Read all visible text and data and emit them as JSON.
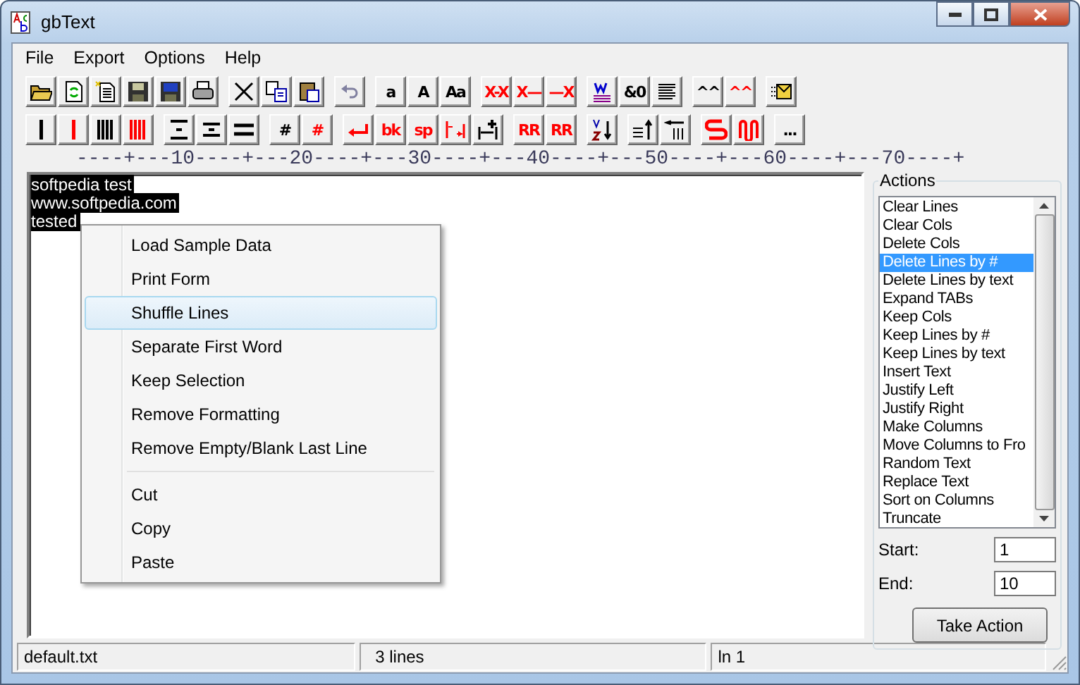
{
  "window": {
    "title": "gbText"
  },
  "menu": [
    "File",
    "Export",
    "Options",
    "Help"
  ],
  "toolbars": [
    [
      [
        {
          "kind": "icon"
        },
        {
          "kind": "icon"
        },
        {
          "kind": "icon"
        },
        {
          "kind": "icon"
        },
        {
          "kind": "icon"
        },
        {
          "kind": "icon"
        }
      ],
      [
        {
          "kind": "icon"
        },
        {
          "kind": "icon"
        },
        {
          "kind": "icon"
        }
      ],
      [
        {
          "kind": "icon"
        }
      ],
      [
        {
          "kind": "text",
          "label": "a",
          "color": "#000000"
        },
        {
          "kind": "text",
          "label": "A",
          "color": "#000000"
        },
        {
          "kind": "text",
          "label": "Aa",
          "color": "#000000"
        }
      ],
      [
        {
          "kind": "text",
          "label": "X-X",
          "color": "#ff0000"
        },
        {
          "kind": "text",
          "label": "X—",
          "color": "#ff0000"
        },
        {
          "kind": "text",
          "label": "—X",
          "color": "#ff0000"
        }
      ],
      [
        {
          "kind": "icon"
        },
        {
          "kind": "text",
          "label": "&0",
          "color": "#000000"
        },
        {
          "kind": "icon"
        }
      ],
      [
        {
          "kind": "text",
          "label": "^^",
          "color": "#000000"
        },
        {
          "kind": "text",
          "label": "^^",
          "color": "#ff0000"
        }
      ],
      [
        {
          "kind": "icon"
        }
      ]
    ],
    [
      [
        {
          "kind": "icon",
          "color": "#000000"
        },
        {
          "kind": "icon",
          "color": "#ff0000"
        },
        {
          "kind": "icon",
          "color": "#000000"
        },
        {
          "kind": "icon",
          "color": "#ff0000"
        }
      ],
      [
        {
          "kind": "icon"
        },
        {
          "kind": "icon"
        },
        {
          "kind": "icon"
        }
      ],
      [
        {
          "kind": "text",
          "label": "#",
          "color": "#000000"
        },
        {
          "kind": "text",
          "label": "#",
          "color": "#ff0000"
        }
      ],
      [
        {
          "kind": "icon",
          "color": "#ff0000"
        },
        {
          "kind": "text",
          "label": "bk",
          "color": "#ff0000"
        },
        {
          "kind": "text",
          "label": "sp",
          "color": "#ff0000"
        },
        {
          "kind": "icon",
          "color": "#ff0000"
        },
        {
          "kind": "icon",
          "color": "#000000"
        }
      ],
      [
        {
          "kind": "text",
          "label": "RR",
          "color": "#ff0000"
        },
        {
          "kind": "text",
          "label": "RR",
          "color": "#ff0000"
        }
      ],
      [
        {
          "kind": "icon"
        }
      ],
      [
        {
          "kind": "icon"
        },
        {
          "kind": "icon"
        }
      ],
      [
        {
          "kind": "icon",
          "color": "#ff0000"
        },
        {
          "kind": "icon",
          "color": "#ff0000"
        }
      ],
      [
        {
          "kind": "text",
          "label": "...",
          "color": "#000000"
        }
      ]
    ]
  ],
  "ruler": "----+---10----+---20----+---30----+---40----+---50----+---60----+---70----+",
  "editor": {
    "lines": [
      "softpedia test",
      "www.softpedia.com",
      "tested"
    ]
  },
  "context_menu": [
    {
      "kind": "item",
      "label": "Load Sample Data",
      "selected": false
    },
    {
      "kind": "item",
      "label": "Print Form",
      "selected": false
    },
    {
      "kind": "item",
      "label": "Shuffle Lines",
      "selected": true
    },
    {
      "kind": "item",
      "label": "Separate First Word",
      "selected": false
    },
    {
      "kind": "item",
      "label": "Keep Selection",
      "selected": false
    },
    {
      "kind": "item",
      "label": "Remove Formatting",
      "selected": false
    },
    {
      "kind": "item",
      "label": "Remove Empty/Blank Last Line",
      "selected": false
    },
    {
      "kind": "separator"
    },
    {
      "kind": "item",
      "label": "Cut",
      "selected": false
    },
    {
      "kind": "item",
      "label": "Copy",
      "selected": false
    },
    {
      "kind": "item",
      "label": "Paste",
      "selected": false
    }
  ],
  "actions": {
    "title": "Actions",
    "items": [
      {
        "label": "Clear Lines",
        "selected": false
      },
      {
        "label": "Clear Cols",
        "selected": false
      },
      {
        "label": "Delete Cols",
        "selected": false
      },
      {
        "label": "Delete Lines by #",
        "selected": true
      },
      {
        "label": "Delete Lines by text",
        "selected": false
      },
      {
        "label": "Expand TABs",
        "selected": false
      },
      {
        "label": "Keep Cols",
        "selected": false
      },
      {
        "label": "Keep Lines by #",
        "selected": false
      },
      {
        "label": "Keep Lines by text",
        "selected": false
      },
      {
        "label": "Insert Text",
        "selected": false
      },
      {
        "label": "Justify Left",
        "selected": false
      },
      {
        "label": "Justify Right",
        "selected": false
      },
      {
        "label": "Make Columns",
        "selected": false
      },
      {
        "label": "Move Columns to Fro",
        "selected": false
      },
      {
        "label": "Random Text",
        "selected": false
      },
      {
        "label": "Replace Text",
        "selected": false
      },
      {
        "label": "Sort on Columns",
        "selected": false
      },
      {
        "label": "Truncate",
        "selected": false
      }
    ],
    "start_label": "Start:",
    "start_value": "1",
    "end_label": "End:",
    "end_value": "10",
    "button": "Take Action"
  },
  "status_bar": [
    "default.txt",
    "3 lines",
    "ln 1"
  ]
}
